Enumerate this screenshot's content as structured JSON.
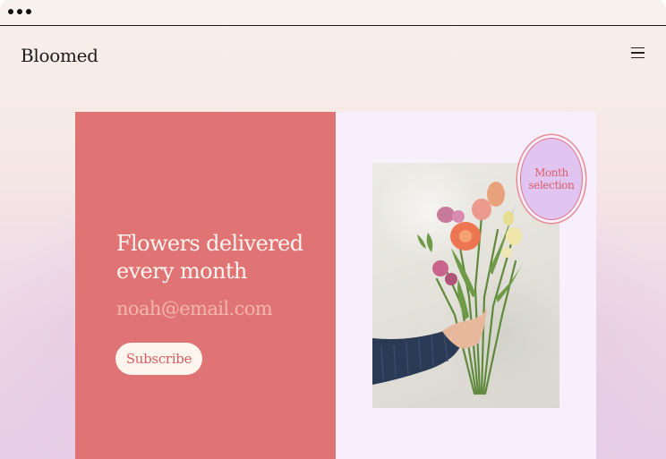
{
  "brand": {
    "name": "Bloomed"
  },
  "header": {
    "menu_icon": "hamburger-menu-icon"
  },
  "hero": {
    "headline_line1": "Flowers delivered",
    "headline_line2": "every month",
    "email_placeholder": "noah@email.com",
    "subscribe_label": "Subscribe",
    "panel_color": "#e07474"
  },
  "feature": {
    "badge_line1": "Month",
    "badge_line2": "selection",
    "panel_color": "#f7effb",
    "badge_color": "#e2c4f0"
  }
}
